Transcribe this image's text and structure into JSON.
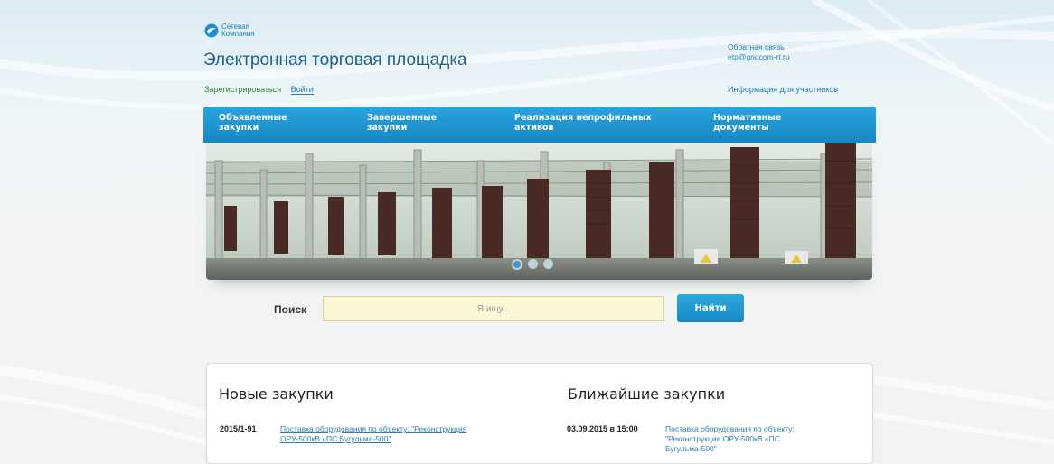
{
  "logo": {
    "line1": "Сетевая",
    "line2": "Компания"
  },
  "header": {
    "title": "Электронная торговая площадка",
    "register_label": "Зарегистрироваться",
    "login_label": "Войти",
    "feedback_label": "Обратная связь",
    "email": "etp@gridcom-rt.ru",
    "info_link": "Информация для участников"
  },
  "nav": {
    "items": [
      {
        "line1": "Объявленные",
        "line2": "закупки"
      },
      {
        "line1": "Завершенные",
        "line2": "закупки"
      },
      {
        "line1": "Реализация непрофильных",
        "line2": "активов"
      },
      {
        "line1": "Нормативные",
        "line2": "документы"
      }
    ]
  },
  "slider": {
    "dots": 3,
    "active_index": 0
  },
  "search": {
    "label": "Поиск",
    "placeholder": "Я ищу...",
    "button_label": "Найти"
  },
  "new_purchases": {
    "title": "Новые закупки",
    "items": [
      {
        "id": "2015/1-91",
        "line1": "Поставка оборудования по объекту: \"Реконструкция",
        "line2": "ОРУ-500кВ «ПС Бугульма-500\""
      }
    ]
  },
  "upcoming_purchases": {
    "title": "Ближайшие закупки",
    "items": [
      {
        "date": "03.09.2015 в 15:00",
        "line1": "Поставка оборудования по объекту:",
        "line2": "\"Реконструкция ОРУ-500кВ «ПС",
        "line3": "Бугульма-500\""
      }
    ]
  },
  "colors": {
    "accent": "#1f8fd0",
    "nav_bg": "#1e96d3",
    "title": "#1b5f8f",
    "link": "#2a7fb7",
    "register": "#2e8a2e",
    "search_bg": "#fbf7d4"
  }
}
